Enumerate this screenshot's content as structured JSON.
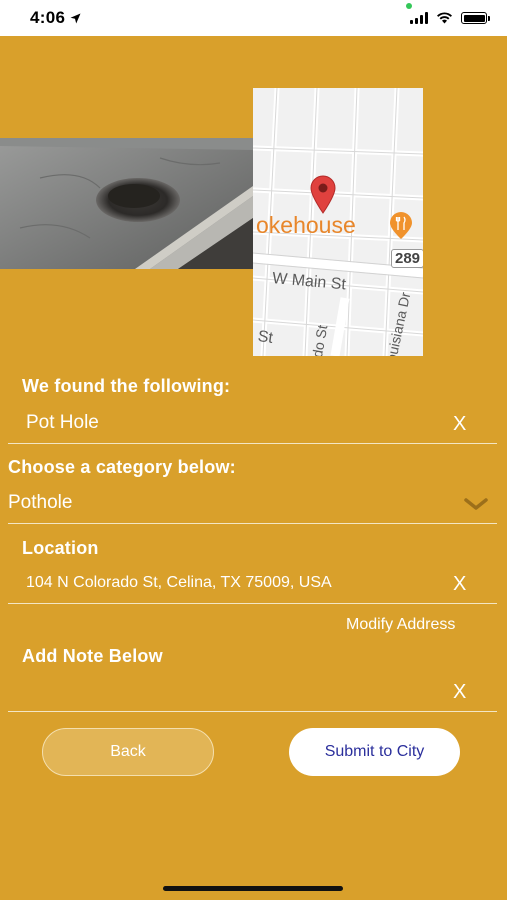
{
  "status_bar": {
    "time": "4:06"
  },
  "found": {
    "heading": "We found the following:",
    "value": "Pot Hole",
    "clear_label": "X"
  },
  "category": {
    "heading": "Choose a category below:",
    "selected": "Pothole"
  },
  "location": {
    "heading": "Location",
    "value": "104 N Colorado St, Celina, TX 75009, USA",
    "clear_label": "X",
    "modify_label": "Modify Address"
  },
  "note": {
    "heading": "Add Note Below",
    "value": "",
    "clear_label": "X"
  },
  "map": {
    "place_label": "okehouse",
    "street_main": "W Main St",
    "street_st": "St",
    "street_colorado": "do St",
    "street_louisiana": "ouisiana Dr",
    "route_badge": "289"
  },
  "buttons": {
    "back": "Back",
    "submit": "Submit to City"
  },
  "colors": {
    "background": "#d9a02b",
    "submit_text": "#2b2f9c",
    "map_pin": "#e0413e",
    "place_label": "#e8862a"
  }
}
